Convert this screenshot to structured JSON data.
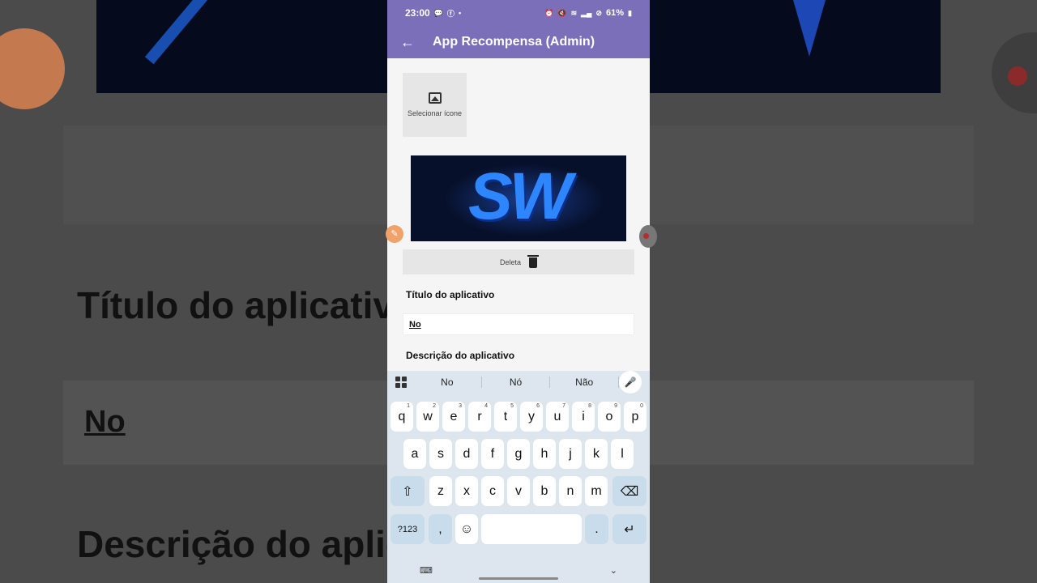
{
  "status": {
    "time": "23:00",
    "battery": "61%"
  },
  "appbar": {
    "back_icon": "arrow-left-icon",
    "title": "App Recompensa (Admin)"
  },
  "form": {
    "select_icon_label": "Selecionar ícone",
    "banner_text": "SW",
    "delete_label": "Deleta",
    "title_label": "Título do aplicativo",
    "title_value": "No",
    "desc_label": "Descrição do aplicativo"
  },
  "background": {
    "title_label": "Título do aplicativo",
    "title_value": "No",
    "desc_label": "Descrição do aplica"
  },
  "keyboard": {
    "suggestions": [
      "No",
      "Nó",
      "Não"
    ],
    "row1": [
      {
        "k": "q",
        "n": "1"
      },
      {
        "k": "w",
        "n": "2"
      },
      {
        "k": "e",
        "n": "3"
      },
      {
        "k": "r",
        "n": "4"
      },
      {
        "k": "t",
        "n": "5"
      },
      {
        "k": "y",
        "n": "6"
      },
      {
        "k": "u",
        "n": "7"
      },
      {
        "k": "i",
        "n": "8"
      },
      {
        "k": "o",
        "n": "9"
      },
      {
        "k": "p",
        "n": "0"
      }
    ],
    "row2": [
      "a",
      "s",
      "d",
      "f",
      "g",
      "h",
      "j",
      "k",
      "l"
    ],
    "row3": [
      "z",
      "x",
      "c",
      "v",
      "b",
      "n",
      "m"
    ],
    "symbols_label": "?123",
    "comma": ",",
    "period": "."
  }
}
